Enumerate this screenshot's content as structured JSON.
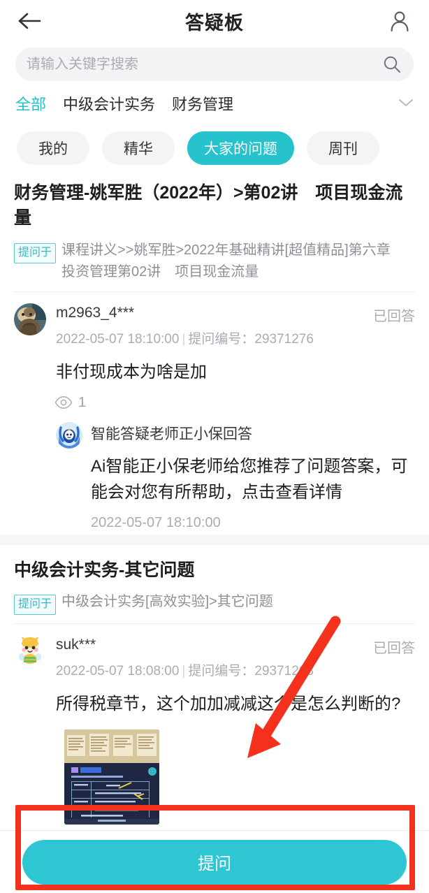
{
  "header": {
    "title": "答疑板",
    "back_icon": "arrow-left-icon",
    "profile_icon": "user-icon"
  },
  "search": {
    "placeholder": "请输入关键字搜索",
    "value": "",
    "icon": "search-icon"
  },
  "categories": {
    "items": [
      {
        "label": "全部",
        "active": true
      },
      {
        "label": "中级会计实务",
        "active": false
      },
      {
        "label": "财务管理",
        "active": false
      }
    ],
    "expand_icon": "chevron-down-icon"
  },
  "chips": [
    {
      "label": "我的",
      "active": false
    },
    {
      "label": "精华",
      "active": false
    },
    {
      "label": "大家的问题",
      "active": true
    },
    {
      "label": "周刊",
      "active": false
    }
  ],
  "cards": [
    {
      "title": "财务管理-姚军胜（2022年）>第02讲　项目现金流量",
      "askfrom_badge": "提问于",
      "askfrom_path": "课程讲义>>姚军胜>2022年基础精讲[超值精品]第六章　投资管理第02讲　项目现金流量",
      "post": {
        "avatar": "user-photo-avatar",
        "username": "m2963_4***",
        "status": "已回答",
        "time": "2022-05-07 18:10:00",
        "id_label": "提问编号：",
        "id_value": "29371276",
        "body": "非付现成本为啥是加",
        "views_icon": "eye-icon",
        "views_count": "1"
      },
      "ai_answer": {
        "avatar": "ai-mascot-avatar",
        "title": "智能答疑老师正小保回答",
        "text": "Ai智能正小保老师给您推荐了问题答案，可能会对您有所帮助，点击查看详情",
        "time": "2022-05-07 18:10:00"
      }
    },
    {
      "title": "中级会计实务-其它问题",
      "askfrom_badge": "提问于",
      "askfrom_path": "中级会计实务[高效实验]>其它问题",
      "post": {
        "avatar": "bee-mascot-avatar",
        "username": "suk***",
        "status": "已回答",
        "time": "2022-05-07 18:08:00",
        "id_label": "提问编号：",
        "id_value": "29371268",
        "body": "所得税章节，这个加加减减这个是怎么判断的?",
        "attachment": "lecture-slide-photo"
      }
    }
  ],
  "bottom": {
    "ask_label": "提问"
  },
  "colors": {
    "accent": "#2ec6d2",
    "chip_active": "#27c3cd",
    "category_active": "#21c0c9",
    "badge_border": "#57c9cf",
    "badge_text": "#38b9c2",
    "annotation": "#f4311c",
    "muted_text": "#a8acb3",
    "primary_text": "#1e1e1e",
    "search_bg": "#f2f3f5"
  },
  "annotations": {
    "highlight_rect": "red-rectangle-highlight",
    "pointer_arrow": "red-arrow-annotation"
  }
}
